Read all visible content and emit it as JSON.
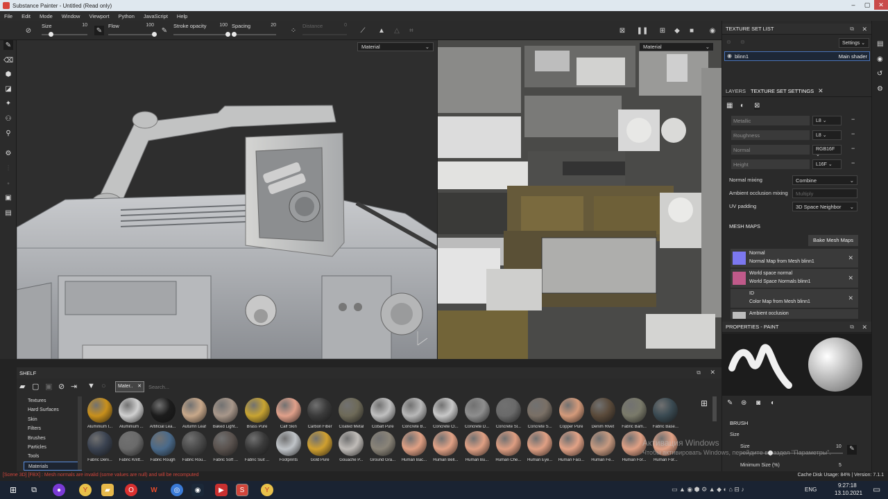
{
  "window": {
    "title": "Substance Painter - Untitled (Read only)",
    "controls": [
      "–",
      "▢",
      "✕"
    ]
  },
  "menu": [
    "File",
    "Edit",
    "Mode",
    "Window",
    "Viewport",
    "Python",
    "JavaScript",
    "Help"
  ],
  "tool_options": {
    "size": {
      "label": "Size",
      "value": "10",
      "level": 0.2
    },
    "flow": {
      "label": "Flow",
      "value": "100",
      "level": 1.0
    },
    "stroke_opacity": {
      "label": "Stroke opacity",
      "value": "100",
      "level": 1.0
    },
    "spacing": {
      "label": "Spacing",
      "value": "20",
      "level": 0.05
    },
    "distance": {
      "label": "Distance",
      "value": "0",
      "level": 0.0
    }
  },
  "viewport3d": {
    "mode": "Material"
  },
  "viewport2d": {
    "mode": "Material"
  },
  "texture_set_list": {
    "title": "TEXTURE SET LIST",
    "settings_label": "Settings",
    "item": {
      "name": "blinn1",
      "shader": "Main shader"
    }
  },
  "layers_tabs": {
    "layers": "LAYERS",
    "tss": "TEXTURE SET SETTINGS"
  },
  "channels": [
    {
      "name": "Metallic",
      "format": "L8"
    },
    {
      "name": "Roughness",
      "format": "L8"
    },
    {
      "name": "Normal",
      "format": "RGB16F"
    },
    {
      "name": "Height",
      "format": "L16F"
    }
  ],
  "settings": {
    "normal_mixing": {
      "label": "Normal mixing",
      "value": "Combine"
    },
    "ao_mixing": {
      "label": "Ambient occlusion mixing",
      "value": "Multiply"
    },
    "uv_padding": {
      "label": "UV padding",
      "value": "3D Space Neighbor"
    }
  },
  "mesh_maps": {
    "title": "MESH MAPS",
    "bake_button": "Bake Mesh Maps",
    "items": [
      {
        "title": "Normal",
        "subtitle": "Normal Map from Mesh blinn1",
        "color": "#7c78f0"
      },
      {
        "title": "World space normal",
        "subtitle": "World Space Normals blinn1",
        "color": "#c05a8a"
      },
      {
        "title": "ID",
        "subtitle": "Color Map from Mesh blinn1",
        "color": "#3a3a3a"
      },
      {
        "title": "Ambient occlusion",
        "subtitle": "",
        "color": "#bdbdbd"
      }
    ]
  },
  "properties": {
    "title": "PROPERTIES - PAINT",
    "section": "BRUSH",
    "size_label": "Size",
    "size_row_label": "Size",
    "size_value": "10",
    "min_size_label": "Minimum Size (%)",
    "min_size_value": "5"
  },
  "shelf": {
    "title": "SHELF",
    "filter_tag": "Mater..",
    "search_placeholder": "Search...",
    "categories": [
      "Textures",
      "Hard Surfaces",
      "Skin",
      "Filters",
      "Brushes",
      "Particles",
      "Tools",
      "Materials"
    ],
    "selected_category": "Materials",
    "materials_row1": [
      {
        "name": "Aluminium I...",
        "color": "#c8901c"
      },
      {
        "name": "Aluminium ...",
        "color": "#d0d0d0"
      },
      {
        "name": "Artificial Lea...",
        "color": "#1c1c1c"
      },
      {
        "name": "Autumn Leaf",
        "color": "#c8a88a"
      },
      {
        "name": "Baked Light...",
        "color": "#a8978a"
      },
      {
        "name": "Brass Pure",
        "color": "#c8a432"
      },
      {
        "name": "Calf Skin",
        "color": "#e0a08a"
      },
      {
        "name": "Carbon Fiber",
        "color": "#3a3a3a"
      },
      {
        "name": "Coated Metal",
        "color": "#6e6a58"
      },
      {
        "name": "Cobalt Pure",
        "color": "#c0c0c0"
      },
      {
        "name": "Concrete B...",
        "color": "#b8b8b8"
      },
      {
        "name": "Concrete Cl...",
        "color": "#c8c8c8"
      },
      {
        "name": "Concrete D...",
        "color": "#8e8e8e"
      },
      {
        "name": "Concrete Sl...",
        "color": "#6a6a6a"
      },
      {
        "name": "Concrete S...",
        "color": "#7a7066"
      },
      {
        "name": "Copper Pure",
        "color": "#d49a7a"
      },
      {
        "name": "Denim Rivet",
        "color": "#5a4a3a"
      },
      {
        "name": "Fabric Bam...",
        "color": "#7a7a6a"
      },
      {
        "name": "Fabric Base...",
        "color": "#3a4a52"
      }
    ],
    "materials_row2": [
      {
        "name": "Fabric Deni...",
        "color": "#3a4250"
      },
      {
        "name": "Fabric Knitt...",
        "color": "#6a6a6a"
      },
      {
        "name": "Fabric Rough",
        "color": "#4a6a8a"
      },
      {
        "name": "Fabric Rou...",
        "color": "#4a4a4a"
      },
      {
        "name": "Fabric Soft ...",
        "color": "#5a524e"
      },
      {
        "name": "Fabric Suit ...",
        "color": "#3a3a3a"
      },
      {
        "name": "Footprints",
        "color": "#c0c4c8"
      },
      {
        "name": "Gold Pure",
        "color": "#d0a030"
      },
      {
        "name": "Gouache P...",
        "color": "#c0bcb8"
      },
      {
        "name": "Ground Gra...",
        "color": "#8a8478"
      },
      {
        "name": "Human Bac...",
        "color": "#e0a084"
      },
      {
        "name": "Human Bell...",
        "color": "#e2a286"
      },
      {
        "name": "Human Bu...",
        "color": "#e0a084"
      },
      {
        "name": "Human Che...",
        "color": "#de9e82"
      },
      {
        "name": "Human Eye...",
        "color": "#e0a084"
      },
      {
        "name": "Human Faci...",
        "color": "#e2a286"
      },
      {
        "name": "Human Fe...",
        "color": "#c89a80"
      },
      {
        "name": "Human For...",
        "color": "#e0a084"
      },
      {
        "name": "Human For...",
        "color": "#e2a286"
      }
    ]
  },
  "status": {
    "error": "[Scene 3D] [FBX] : Mesh normals are invalid (some values are null) and will be recomputed",
    "right": "Cache Disk Usage:  84% | Version: 7.1.1"
  },
  "watermark": {
    "line1": "Активация Windows",
    "line2": "Чтобы активировать Windows, перейдите в раздел \"Параметры\"."
  },
  "taskbar": {
    "time": "9:27:18",
    "date": "13.10.2021",
    "lang": "ENG"
  }
}
